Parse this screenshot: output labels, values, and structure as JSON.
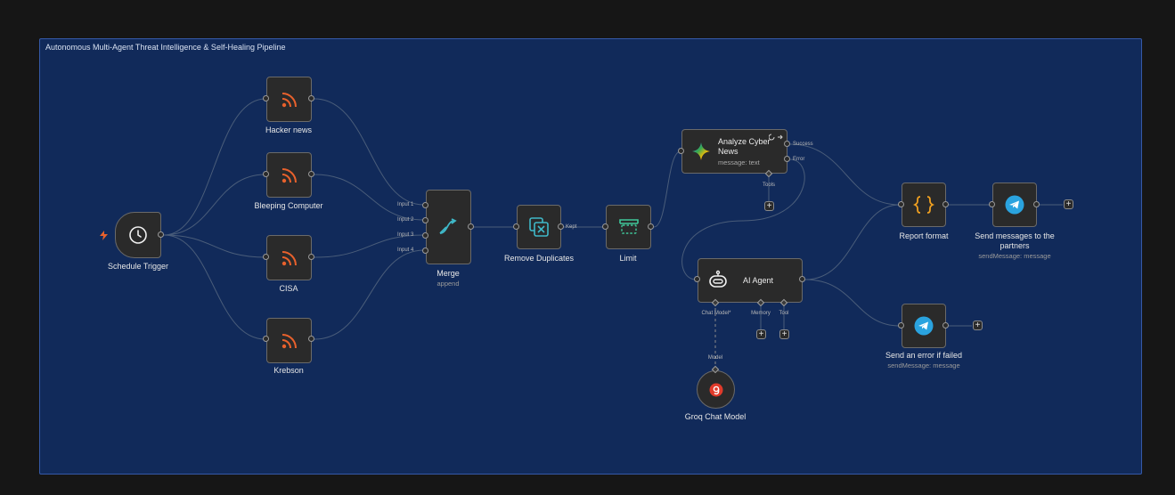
{
  "group": {
    "title": "Autonomous Multi-Agent Threat Intelligence & Self-Healing Pipeline"
  },
  "nodes": {
    "schedule_trigger": {
      "label": "Schedule Trigger"
    },
    "hacker_news": {
      "label": "Hacker news"
    },
    "bleeping_computer": {
      "label": "Bleeping Computer"
    },
    "cisa": {
      "label": "CISA"
    },
    "krebson": {
      "label": "Krebson"
    },
    "merge": {
      "label": "Merge",
      "subtitle": "append",
      "inputs": [
        "Input 1",
        "Input 2",
        "Input 3",
        "Input 4"
      ]
    },
    "remove_duplicates": {
      "label": "Remove Duplicates",
      "output_label": "Kept"
    },
    "limit": {
      "label": "Limit"
    },
    "analyze": {
      "label": "Analyze Cyber News",
      "subtitle": "message: text",
      "outputs": [
        "Success",
        "Error"
      ],
      "connector": "Tools"
    },
    "ai_agent": {
      "label": "AI Agent",
      "connectors": [
        "Chat Model*",
        "Memory",
        "Tool"
      ]
    },
    "groq": {
      "label": "Groq Chat Model",
      "connector": "Model"
    },
    "report_format": {
      "label": "Report format"
    },
    "send_partners": {
      "label": "Send messages to the partners",
      "subtitle": "sendMessage: message"
    },
    "send_error": {
      "label": "Send an error if failed",
      "subtitle": "sendMessage: message"
    }
  },
  "add_symbol": "+",
  "colors": {
    "canvas": "#161616",
    "group_bg": "#112a5a",
    "group_border": "#3559a8",
    "rss": "#e8612c",
    "telegram": "#2aa3df",
    "code": "#f0a020",
    "dedupe": "#3fb8c8",
    "groq": "#e03a2a"
  },
  "icons": {
    "schedule_trigger": "clock-icon",
    "rss_feed": "rss-icon",
    "merge": "merge-icon",
    "remove_duplicates": "dedupe-icon",
    "limit": "limit-icon",
    "analyze": "gemini-icon",
    "ai_agent": "robot-icon",
    "groq": "groq-icon",
    "report_format": "braces-icon",
    "telegram": "telegram-icon",
    "trigger_bolt": "bolt-icon"
  }
}
